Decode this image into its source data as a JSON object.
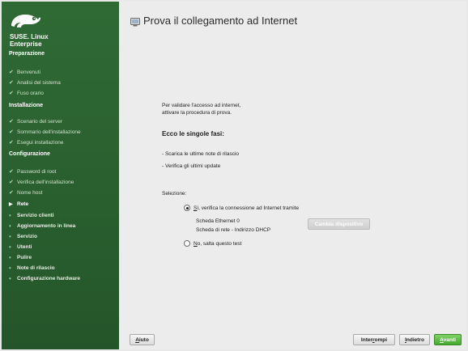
{
  "sidebar": {
    "brand_line1": "SUSE. Linux",
    "brand_line2": "Enterprise",
    "sections": [
      {
        "title": "Preparazione"
      },
      {
        "title": "Installazione"
      },
      {
        "title": "Configurazione"
      }
    ],
    "items": [
      {
        "label": "Benvenuti"
      },
      {
        "label": "Analisi del sistema"
      },
      {
        "label": "Fuso orario"
      },
      {
        "label": "Scenario del server"
      },
      {
        "label": "Sommario dell'installazione"
      },
      {
        "label": "Esegui installazione"
      },
      {
        "label": "Password di root"
      },
      {
        "label": "Verifica dell'installazione"
      },
      {
        "label": "Nome host"
      },
      {
        "label": "Rete"
      },
      {
        "label": "Servizio clienti"
      },
      {
        "label": "Aggiornamento in linea"
      },
      {
        "label": "Servizio"
      },
      {
        "label": "Utenti"
      },
      {
        "label": "Pulire"
      },
      {
        "label": "Note di rilascio"
      },
      {
        "label": "Configurazione hardware"
      }
    ]
  },
  "main": {
    "title": "Prova il collegamento ad Internet",
    "intro_line1": "Per validare l'accesso ad internet,",
    "intro_line2": "attivare la procedura di prova.",
    "steps_heading": "Ecco le singole fasi:",
    "steps": [
      "- Scarica le ultime note di rilascio",
      "- Verifica gli ultimi update"
    ],
    "selection_label": "Selezione:",
    "option_yes_key": "S",
    "option_yes_rest": "ì, verifica la connessione ad Internet tramite",
    "device_line1": "Scheda Ethernet 0",
    "device_line2": "Scheda di rete - Indirizzo DHCP",
    "change_device_label": "Cambia dispositivo",
    "option_no_key": "N",
    "option_no_rest": "o, salta questo test"
  },
  "buttons": {
    "help_key": "A",
    "help_rest": "iuto",
    "abort_pre": "Inter",
    "abort_key": "r",
    "abort_post": "ompi",
    "back_key": "I",
    "back_rest": "ndietro",
    "next_key": "A",
    "next_rest": "vanti"
  },
  "colors": {
    "sidebar_green": "#2b6130",
    "next_button_green": "#45a92f"
  }
}
